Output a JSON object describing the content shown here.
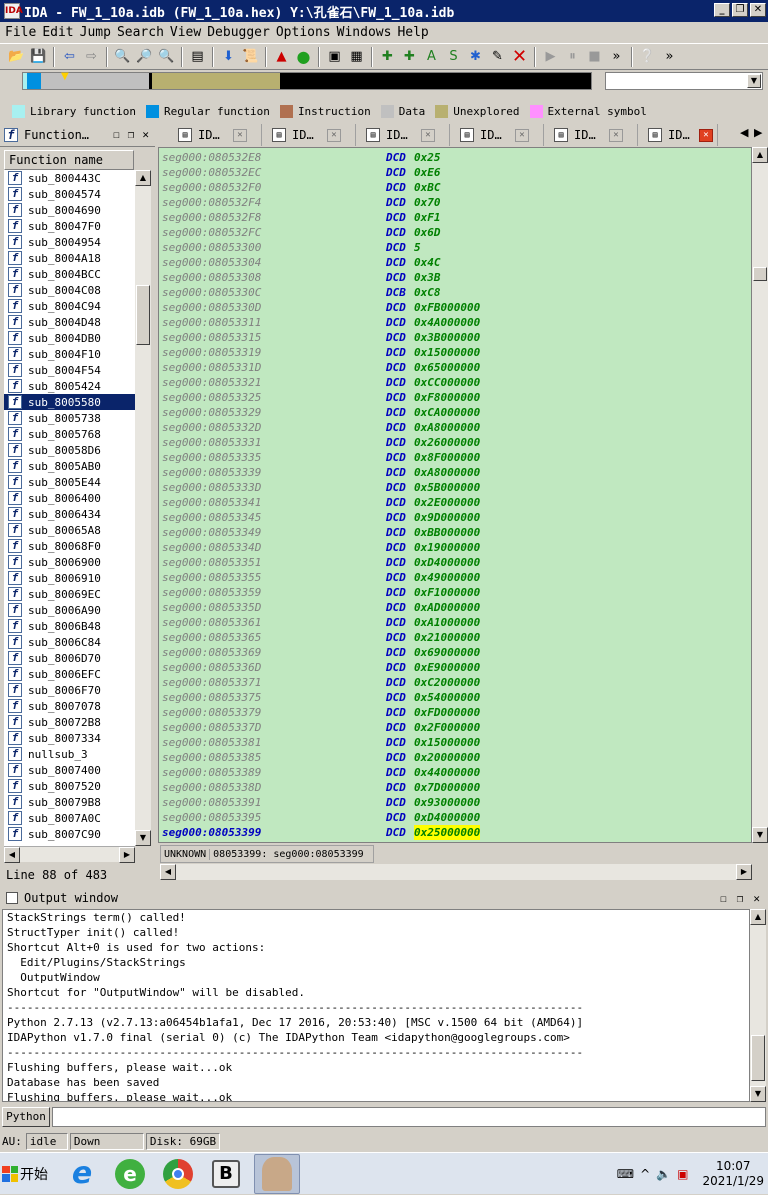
{
  "window": {
    "title": "IDA - FW_1_10a.idb (FW_1_10a.hex) Y:\\孔雀石\\FW_1_10a.idb",
    "app_icon": "IDA"
  },
  "menu": [
    "File",
    "Edit",
    "Jump",
    "Search",
    "View",
    "Debugger",
    "Options",
    "Windows",
    "Help"
  ],
  "legend": [
    {
      "label": "Library function",
      "color": "#a8f0f0"
    },
    {
      "label": "Regular function",
      "color": "#0090e0"
    },
    {
      "label": "Instruction",
      "color": "#b07050"
    },
    {
      "label": "Data",
      "color": "#c0c0c0"
    },
    {
      "label": "Unexplored",
      "color": "#b8b070"
    },
    {
      "label": "External symbol",
      "color": "#ff90ff"
    }
  ],
  "functions_panel": {
    "title": "Function…",
    "column_header": "Function name",
    "items": [
      "sub_800443C",
      "sub_8004574",
      "sub_8004690",
      "sub_80047F0",
      "sub_8004954",
      "sub_8004A18",
      "sub_8004BCC",
      "sub_8004C08",
      "sub_8004C94",
      "sub_8004D48",
      "sub_8004DB0",
      "sub_8004F10",
      "sub_8004F54",
      "sub_8005424",
      "sub_8005580",
      "sub_8005738",
      "sub_8005768",
      "sub_80058D6",
      "sub_8005AB0",
      "sub_8005E44",
      "sub_8006400",
      "sub_8006434",
      "sub_80065A8",
      "sub_80068F0",
      "sub_8006900",
      "sub_8006910",
      "sub_80069EC",
      "sub_8006A90",
      "sub_8006B48",
      "sub_8006C84",
      "sub_8006D70",
      "sub_8006EFC",
      "sub_8006F70",
      "sub_8007078",
      "sub_80072B8",
      "sub_8007334",
      "nullsub_3",
      "sub_8007400",
      "sub_8007520",
      "sub_80079B8",
      "sub_8007A0C",
      "sub_8007C90"
    ],
    "selected": "sub_8005580",
    "line_status": "Line 88 of 483"
  },
  "tabs": [
    "ID…",
    "ID…",
    "ID…",
    "ID…",
    "ID…",
    "ID…"
  ],
  "disasm": {
    "lines": [
      {
        "addr": "seg000:080532E8",
        "kw": "DCD",
        "val": "0x25"
      },
      {
        "addr": "seg000:080532EC",
        "kw": "DCD",
        "val": "0xE6"
      },
      {
        "addr": "seg000:080532F0",
        "kw": "DCD",
        "val": "0xBC"
      },
      {
        "addr": "seg000:080532F4",
        "kw": "DCD",
        "val": "0x70"
      },
      {
        "addr": "seg000:080532F8",
        "kw": "DCD",
        "val": "0xF1"
      },
      {
        "addr": "seg000:080532FC",
        "kw": "DCD",
        "val": "0x6D"
      },
      {
        "addr": "seg000:08053300",
        "kw": "DCD",
        "val": "5"
      },
      {
        "addr": "seg000:08053304",
        "kw": "DCD",
        "val": "0x4C"
      },
      {
        "addr": "seg000:08053308",
        "kw": "DCD",
        "val": "0x3B"
      },
      {
        "addr": "seg000:0805330C",
        "kw": "DCB",
        "val": "0xC8"
      },
      {
        "addr": "seg000:0805330D",
        "kw": "DCD",
        "val": "0xFB000000"
      },
      {
        "addr": "seg000:08053311",
        "kw": "DCD",
        "val": "0x4A000000"
      },
      {
        "addr": "seg000:08053315",
        "kw": "DCD",
        "val": "0x3B000000"
      },
      {
        "addr": "seg000:08053319",
        "kw": "DCD",
        "val": "0x15000000"
      },
      {
        "addr": "seg000:0805331D",
        "kw": "DCD",
        "val": "0x65000000"
      },
      {
        "addr": "seg000:08053321",
        "kw": "DCD",
        "val": "0xCC000000"
      },
      {
        "addr": "seg000:08053325",
        "kw": "DCD",
        "val": "0xF8000000"
      },
      {
        "addr": "seg000:08053329",
        "kw": "DCD",
        "val": "0xCA000000"
      },
      {
        "addr": "seg000:0805332D",
        "kw": "DCD",
        "val": "0xA8000000"
      },
      {
        "addr": "seg000:08053331",
        "kw": "DCD",
        "val": "0x26000000"
      },
      {
        "addr": "seg000:08053335",
        "kw": "DCD",
        "val": "0x8F000000"
      },
      {
        "addr": "seg000:08053339",
        "kw": "DCD",
        "val": "0xA8000000"
      },
      {
        "addr": "seg000:0805333D",
        "kw": "DCD",
        "val": "0x5B000000"
      },
      {
        "addr": "seg000:08053341",
        "kw": "DCD",
        "val": "0x2E000000"
      },
      {
        "addr": "seg000:08053345",
        "kw": "DCD",
        "val": "0x9D000000"
      },
      {
        "addr": "seg000:08053349",
        "kw": "DCD",
        "val": "0xBB000000"
      },
      {
        "addr": "seg000:0805334D",
        "kw": "DCD",
        "val": "0x19000000"
      },
      {
        "addr": "seg000:08053351",
        "kw": "DCD",
        "val": "0xD4000000"
      },
      {
        "addr": "seg000:08053355",
        "kw": "DCD",
        "val": "0x49000000"
      },
      {
        "addr": "seg000:08053359",
        "kw": "DCD",
        "val": "0xF1000000"
      },
      {
        "addr": "seg000:0805335D",
        "kw": "DCD",
        "val": "0xAD000000"
      },
      {
        "addr": "seg000:08053361",
        "kw": "DCD",
        "val": "0xA1000000"
      },
      {
        "addr": "seg000:08053365",
        "kw": "DCD",
        "val": "0x21000000"
      },
      {
        "addr": "seg000:08053369",
        "kw": "DCD",
        "val": "0x69000000"
      },
      {
        "addr": "seg000:0805336D",
        "kw": "DCD",
        "val": "0xE9000000"
      },
      {
        "addr": "seg000:08053371",
        "kw": "DCD",
        "val": "0xC2000000"
      },
      {
        "addr": "seg000:08053375",
        "kw": "DCD",
        "val": "0x54000000"
      },
      {
        "addr": "seg000:08053379",
        "kw": "DCD",
        "val": "0xFD000000"
      },
      {
        "addr": "seg000:0805337D",
        "kw": "DCD",
        "val": "0x2F000000"
      },
      {
        "addr": "seg000:08053381",
        "kw": "DCD",
        "val": "0x15000000"
      },
      {
        "addr": "seg000:08053385",
        "kw": "DCD",
        "val": "0x20000000"
      },
      {
        "addr": "seg000:08053389",
        "kw": "DCD",
        "val": "0x44000000"
      },
      {
        "addr": "seg000:0805338D",
        "kw": "DCD",
        "val": "0x7D000000"
      },
      {
        "addr": "seg000:08053391",
        "kw": "DCD",
        "val": "0x93000000"
      },
      {
        "addr": "seg000:08053395",
        "kw": "DCD",
        "val": "0xD4000000"
      },
      {
        "addr": "seg000:08053399",
        "kw": "DCD",
        "val": "0x25000000"
      }
    ],
    "current_index": 45,
    "status_left": "UNKNOWN",
    "status_right": "08053399: seg000:08053399"
  },
  "output": {
    "title": "Output window",
    "lines": [
      "StackStrings term() called!",
      "StructTyper init() called!",
      "Shortcut Alt+0 is used for two actions:",
      "  Edit/Plugins/StackStrings",
      "  OutputWindow",
      "Shortcut for \"OutputWindow\" will be disabled.",
      "---------------------------------------------------------------------------------------",
      "Python 2.7.13 (v2.7.13:a06454b1afa1, Dec 17 2016, 20:53:40) [MSC v.1500 64 bit (AMD64)]",
      "IDAPython v1.7.0 final (serial 0) (c) The IDAPython Team <idapython@googlegroups.com>",
      "---------------------------------------------------------------------------------------",
      "Flushing buffers, please wait...ok",
      "Database has been saved",
      "Flushing buffers, please wait...ok"
    ]
  },
  "python_button": "Python",
  "status": {
    "au": "AU:",
    "state": "idle",
    "direction": "Down",
    "disk": "Disk: 69GB"
  },
  "taskbar": {
    "start": "开始",
    "time": "10:07",
    "date": "2021/1/29"
  }
}
